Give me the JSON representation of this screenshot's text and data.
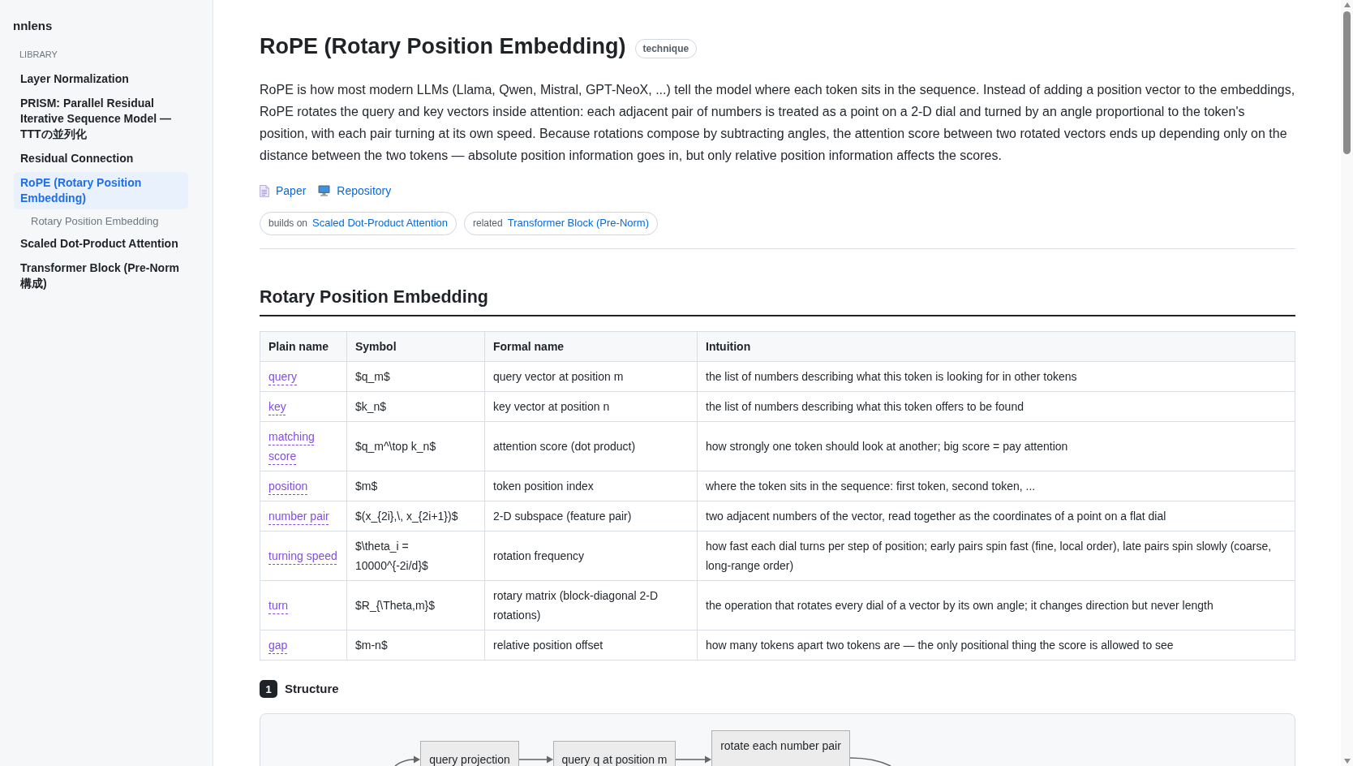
{
  "sidebar": {
    "brand": "nnlens",
    "section_label": "LIBRARY",
    "items": [
      {
        "label": "Layer Normalization",
        "selected": false
      },
      {
        "label": "PRISM: Parallel Residual Iterative Sequence Model — TTTの並列化",
        "selected": false
      },
      {
        "label": "Residual Connection",
        "selected": false
      },
      {
        "label": "RoPE (Rotary Position Embedding)",
        "selected": true,
        "children": [
          {
            "label": "Rotary Position Embedding",
            "selected": false
          }
        ]
      },
      {
        "label": "Scaled Dot-Product Attention",
        "selected": false
      },
      {
        "label": "Transformer Block (Pre-Norm 構成)",
        "selected": false
      }
    ]
  },
  "article": {
    "title": "RoPE (Rotary Position Embedding)",
    "badge": "technique",
    "description": "RoPE is how most modern LLMs (Llama, Qwen, Mistral, GPT-NeoX, ...) tell the model where each token sits in the sequence. Instead of adding a position vector to the embeddings, RoPE rotates the query and key vectors inside attention: each adjacent pair of numbers is treated as a point on a 2-D dial and turned by an angle proportional to the token's position, with each pair turning at its own speed. Because rotations compose by subtracting angles, the attention score between two rotated vectors ends up depending only on the distance between the two tokens — absolute position information goes in, but only relative position information affects the scores.",
    "links": [
      {
        "kind": "paper",
        "label": "Paper"
      },
      {
        "kind": "repository",
        "label": "Repository"
      }
    ],
    "relations": [
      {
        "label": "builds on",
        "target": "Scaled Dot-Product Attention"
      },
      {
        "label": "related",
        "target": "Transformer Block (Pre-Norm)"
      }
    ]
  },
  "section": {
    "title": "Rotary Position Embedding",
    "table": {
      "columns": [
        "Plain name",
        "Symbol",
        "Formal name",
        "Intuition"
      ],
      "rows": [
        {
          "plain_name": "query",
          "symbol": "$q_m$",
          "formal_name": "query vector at position m",
          "intuition": "the list of numbers describing what this token is looking for in other tokens"
        },
        {
          "plain_name": "key",
          "symbol": "$k_n$",
          "formal_name": "key vector at position n",
          "intuition": "the list of numbers describing what this token offers to be found"
        },
        {
          "plain_name": "matching score",
          "symbol": "$q_m^\\top k_n$",
          "formal_name": "attention score (dot product)",
          "intuition": "how strongly one token should look at another; big score = pay attention"
        },
        {
          "plain_name": "position",
          "symbol": "$m$",
          "formal_name": "token position index",
          "intuition": "where the token sits in the sequence: first token, second token, ..."
        },
        {
          "plain_name": "number pair",
          "symbol": "$(x_{2i},\\, x_{2i+1})$",
          "formal_name": "2-D subspace (feature pair)",
          "intuition": "two adjacent numbers of the vector, read together as the coordinates of a point on a flat dial"
        },
        {
          "plain_name": "turning speed",
          "symbol": "$\\theta_i = 10000^{-2i/d}$",
          "formal_name": "rotation frequency",
          "intuition": "how fast each dial turns per step of position; early pairs spin fast (fine, local order), late pairs spin slowly (coarse, long-range order)"
        },
        {
          "plain_name": "turn",
          "symbol": "$R_{\\Theta,m}$",
          "formal_name": "rotary matrix (block-diagonal 2-D rotations)",
          "intuition": "the operation that rotates every dial of a vector by its own angle; it changes direction but never length"
        },
        {
          "plain_name": "gap",
          "symbol": "$m-n$",
          "formal_name": "relative position offset",
          "intuition": "how many tokens apart two tokens are — the only positional thing the score is allowed to see"
        }
      ]
    }
  },
  "structure": {
    "number": "1",
    "title": "Structure",
    "diagram": {
      "nodes": [
        {
          "label": "query projection"
        },
        {
          "label": "query q at position m"
        },
        {
          "label": "rotate each number pair"
        }
      ]
    }
  }
}
